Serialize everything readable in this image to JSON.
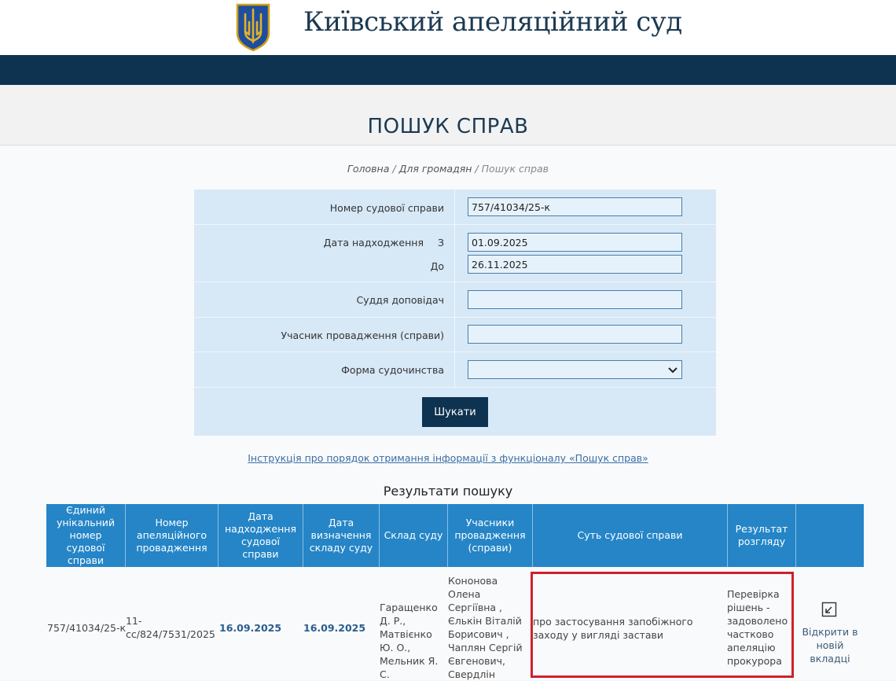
{
  "header": {
    "site_title": "Київський апеляційний суд",
    "logo_icon": "trident-coat-of-arms-icon"
  },
  "page": {
    "title": "ПОШУК СПРАВ",
    "breadcrumb": [
      "Головна",
      "Для громадян",
      "Пошук справ"
    ]
  },
  "colors": {
    "navbar": "#0e3350",
    "table_header": "#2585c7",
    "form_bg": "#d7e8f6",
    "highlight": "#d0212d"
  },
  "form": {
    "case_number_label": "Номер судової справи",
    "case_number_value": "757/41034/25-к",
    "date_received_label": "Дата надходження",
    "from_label": "З",
    "date_from_value": "01.09.2025",
    "to_label": "До",
    "date_to_value": "26.11.2025",
    "judge_label": "Суддя доповідач",
    "judge_value": "",
    "participant_label": "Учасник провадження (справи)",
    "participant_value": "",
    "jurisdiction_label": "Форма судочинства",
    "jurisdiction_value": "",
    "search_button": "Шукати"
  },
  "instruction_link": "Інструкція про порядок отримання інформації з функціоналу «Пошук справ»",
  "results": {
    "title": "Результати пошуку",
    "columns": [
      "Єдиний унікальний номер судової справи",
      "Номер апеляційного провадження",
      "Дата надходження судової справи",
      "Дата визначення складу суду",
      "Склад суду",
      "Учасники провадження (справи)",
      "Суть судової справи",
      "Результат розгляду",
      ""
    ],
    "rows": [
      {
        "case_number": "757/41034/25-к",
        "appeal_number": "11-сс/824/7531/2025",
        "date_received": "16.09.2025",
        "date_composition": "16.09.2025",
        "court_composition": "Гаращенко Д. Р., Матвієнко Ю. О., Мельник Я. С.",
        "participants": "Кононова Олена Сергіївна , Єлькін Віталій Борисович , Чаплян Сергій Євгенович, Свердлін Дмитро Валерійович",
        "essence": "про застосування запобіжного заходу у вигляді застави",
        "result": "Перевірка рішень - задоволено частково апеляцію прокурора",
        "open_link": "Відкрити в новій вкладці",
        "open_icon": "open-in-new-tab-icon"
      }
    ]
  }
}
